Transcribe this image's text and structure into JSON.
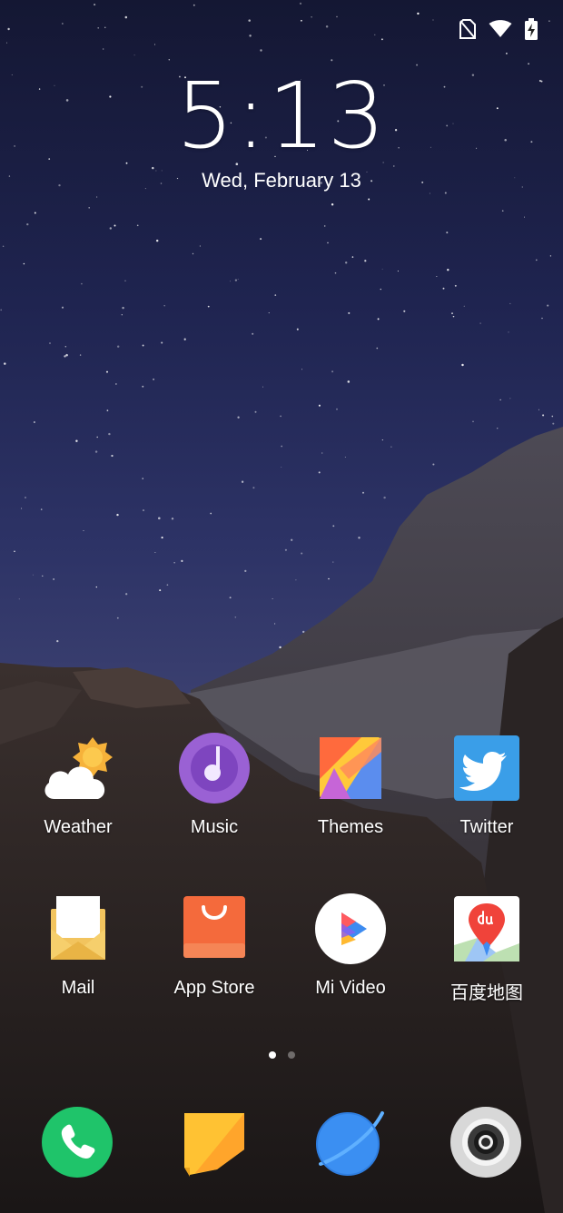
{
  "status_bar": {
    "icons": [
      "no-sim-icon",
      "wifi-icon",
      "battery-charging-icon"
    ]
  },
  "lock_clock": {
    "time": "5:13",
    "date": "Wed, February 13"
  },
  "home_apps": [
    {
      "name": "weather",
      "label": "Weather",
      "icon": "weather-icon"
    },
    {
      "name": "music",
      "label": "Music",
      "icon": "music-icon"
    },
    {
      "name": "themes",
      "label": "Themes",
      "icon": "themes-icon"
    },
    {
      "name": "twitter",
      "label": "Twitter",
      "icon": "twitter-icon"
    },
    {
      "name": "mail",
      "label": "Mail",
      "icon": "mail-icon"
    },
    {
      "name": "app-store",
      "label": "App Store",
      "icon": "app-store-icon"
    },
    {
      "name": "mi-video",
      "label": "Mi Video",
      "icon": "mi-video-icon"
    },
    {
      "name": "baidu-maps",
      "label": "百度地图",
      "icon": "baidu-maps-icon"
    }
  ],
  "page_indicator": {
    "pages": 2,
    "active": 1
  },
  "dock": [
    {
      "name": "phone",
      "icon": "phone-icon"
    },
    {
      "name": "notes",
      "icon": "notes-icon"
    },
    {
      "name": "browser",
      "icon": "browser-icon"
    },
    {
      "name": "camera",
      "icon": "camera-icon"
    }
  ],
  "colors": {
    "sky_top": "#141733",
    "sky_mid": "#2d3366",
    "phone_green": "#1fc46a",
    "music_purple": "#9a61d4",
    "twitter_blue": "#3a9ee8",
    "app_store_orange": "#f46a3c",
    "browser_blue": "#3b8ff2",
    "notes_yellow": "#ffc233"
  }
}
